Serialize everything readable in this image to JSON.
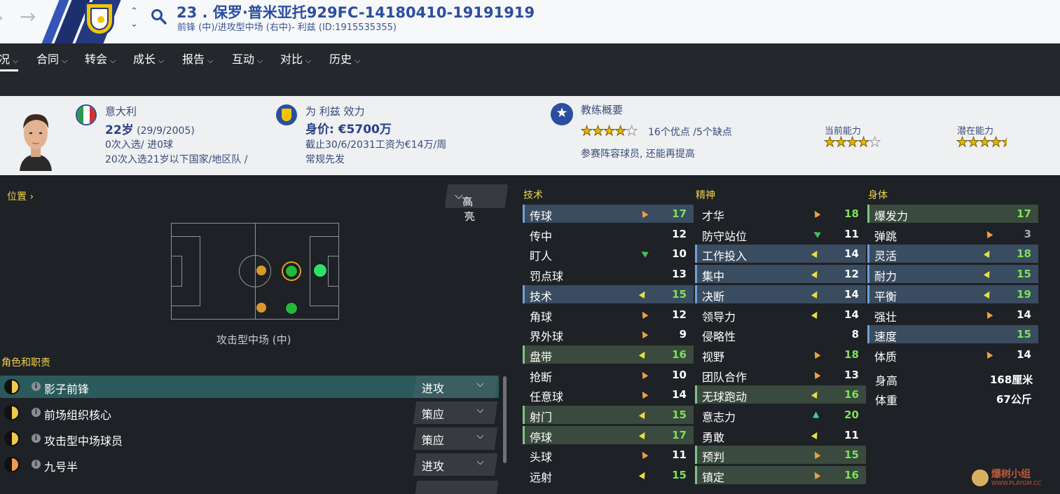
{
  "header": {
    "title": "23 . 保罗·普米亚托929FC-14180410-19191919",
    "subtitle": "前锋 (中)/进攻型中场 (右中)- 利兹 (ID:1915535355)",
    "colors": {
      "accent": "#2a4ea0",
      "stripe_dark": "#1d2f6e",
      "stripe_mid": "#3556b8"
    }
  },
  "nav": {
    "items": [
      {
        "label": "况"
      },
      {
        "label": "合同"
      },
      {
        "label": "转会"
      },
      {
        "label": "成长"
      },
      {
        "label": "报告"
      },
      {
        "label": "互动"
      },
      {
        "label": "对比"
      },
      {
        "label": "历史"
      }
    ]
  },
  "profile": {
    "nationality": "意大利",
    "age": "22岁",
    "dob": "(29/9/2005)",
    "caps": "0次入选/ 进0球",
    "u21": "20次入选21岁以下国家/地区队 /",
    "club_line": "为 利兹 效力",
    "value": "身价: €5700万",
    "contract": "截止30/6/2031工资为€14万/周",
    "status": "常规先发",
    "coach_title": "教练概要",
    "coach_stars": 4,
    "pros_cons": "16个优点 /5个缺点",
    "coach_note": "参赛阵容球员, 还能再提高",
    "ca_label": "当前能力",
    "ca_stars": 4,
    "pa_label": "潜在能力",
    "pa_stars": 4.5
  },
  "position": {
    "title": "位置",
    "highlight_label": "高亮",
    "pitch_label": "攻击型中场 (中)"
  },
  "roles": {
    "title": "角色和职责",
    "items": [
      {
        "name": "影子前锋",
        "duty": "进攻"
      },
      {
        "name": "前场组织核心",
        "duty": "策应"
      },
      {
        "name": "攻击型中场球员",
        "duty": "策应"
      },
      {
        "name": "九号半",
        "duty": "进攻"
      }
    ]
  },
  "attributes": {
    "technical_title": "技术",
    "mental_title": "精神",
    "physical_title": "身体",
    "technical": [
      {
        "name": "传球",
        "value": "17",
        "arrow": "orange"
      },
      {
        "name": "传中",
        "value": "12",
        "arrow": ""
      },
      {
        "name": "盯人",
        "value": "10",
        "arrow": "green"
      },
      {
        "name": "罚点球",
        "value": "13",
        "arrow": ""
      },
      {
        "name": "技术",
        "value": "15",
        "arrow": "yellow"
      },
      {
        "name": "角球",
        "value": "12",
        "arrow": "orange"
      },
      {
        "name": "界外球",
        "value": "9",
        "arrow": "orange"
      },
      {
        "name": "盘带",
        "value": "16",
        "arrow": "yellow"
      },
      {
        "name": "抢断",
        "value": "10",
        "arrow": "orange"
      },
      {
        "name": "任意球",
        "value": "14",
        "arrow": "orange"
      },
      {
        "name": "射门",
        "value": "15",
        "arrow": "yellow"
      },
      {
        "name": "停球",
        "value": "17",
        "arrow": "yellow"
      },
      {
        "name": "头球",
        "value": "11",
        "arrow": "orange"
      },
      {
        "name": "远射",
        "value": "15",
        "arrow": "yellow"
      }
    ],
    "mental": [
      {
        "name": "才华",
        "value": "18",
        "arrow": "orange"
      },
      {
        "name": "防守站位",
        "value": "11",
        "arrow": "green"
      },
      {
        "name": "工作投入",
        "value": "14",
        "arrow": "yellow"
      },
      {
        "name": "集中",
        "value": "12",
        "arrow": "yellow"
      },
      {
        "name": "决断",
        "value": "14",
        "arrow": "yellow"
      },
      {
        "name": "领导力",
        "value": "14",
        "arrow": "yellow"
      },
      {
        "name": "侵略性",
        "value": "8",
        "arrow": ""
      },
      {
        "name": "视野",
        "value": "18",
        "arrow": "orange"
      },
      {
        "name": "团队合作",
        "value": "13",
        "arrow": "orange"
      },
      {
        "name": "无球跑动",
        "value": "16",
        "arrow": "yellow"
      },
      {
        "name": "意志力",
        "value": "20",
        "arrow": "teal"
      },
      {
        "name": "勇敢",
        "value": "11",
        "arrow": "yellow"
      },
      {
        "name": "预判",
        "value": "15",
        "arrow": "orange"
      },
      {
        "name": "镇定",
        "value": "16",
        "arrow": "orange"
      }
    ],
    "physical": [
      {
        "name": "爆发力",
        "value": "17",
        "arrow": ""
      },
      {
        "name": "弹跳",
        "value": "3",
        "arrow": "orange"
      },
      {
        "name": "灵活",
        "value": "18",
        "arrow": "yellow"
      },
      {
        "name": "耐力",
        "value": "15",
        "arrow": "yellow"
      },
      {
        "name": "平衡",
        "value": "19",
        "arrow": "yellow"
      },
      {
        "name": "强壮",
        "value": "14",
        "arrow": "orange"
      },
      {
        "name": "速度",
        "value": "15",
        "arrow": ""
      },
      {
        "name": "体质",
        "value": "14",
        "arrow": "orange"
      }
    ],
    "height_label": "身高",
    "height_value": "168厘米",
    "weight_label": "体重",
    "weight_value": "67公斤"
  },
  "watermark": {
    "line1": "爆树小组",
    "line2": "WWW.PLAYGM.CC"
  }
}
